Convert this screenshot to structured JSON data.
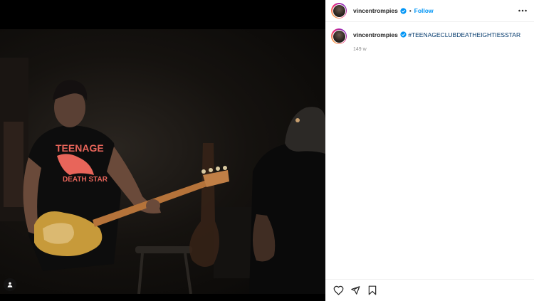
{
  "post": {
    "username": "vincentrompies",
    "follow_label": "Follow",
    "separator": "•",
    "caption_username": "vincentrompies",
    "caption_hashtag": "#TEENAGECLUBDEATHEIGHTIESSTAR",
    "time_ago": "149 w"
  },
  "photo": {
    "shirt_text_line1": "TEENAGE",
    "shirt_text_line2": "DEATH STAR"
  },
  "icons": {
    "verified": "verified-badge-icon",
    "more": "more-options-icon",
    "like": "heart-icon",
    "share": "paper-plane-icon",
    "save": "bookmark-icon",
    "tag": "user-tag-icon"
  },
  "colors": {
    "accent": "#0095f6",
    "hashtag": "#00376b",
    "muted": "#8e8e8e",
    "shirt_print": "#e8655a"
  }
}
